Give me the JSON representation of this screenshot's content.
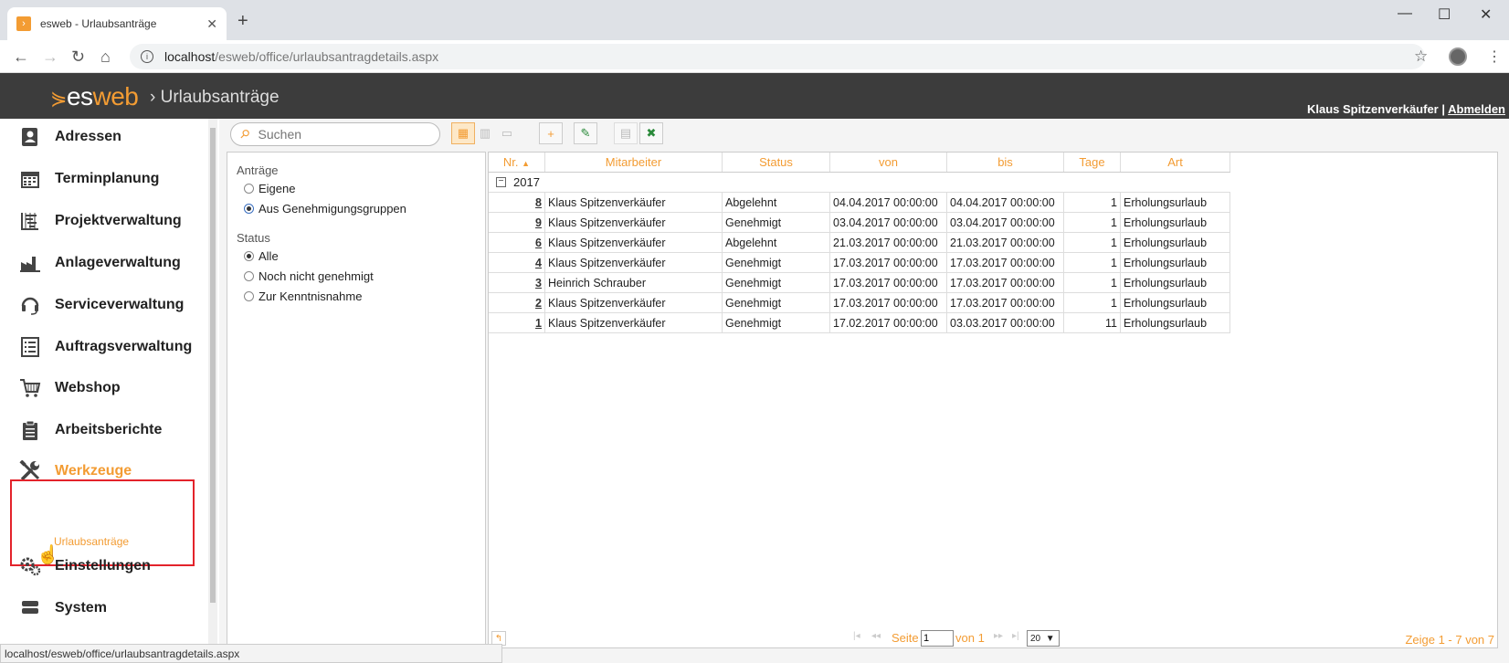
{
  "browser": {
    "tab_title": "esweb - Urlaubsanträge",
    "url_host": "localhost",
    "url_path": "/esweb/office/urlaubsantragdetails.aspx",
    "status_url": "localhost/esweb/office/urlaubsantragdetails.aspx"
  },
  "header": {
    "logo_es": "es",
    "logo_web": "web",
    "breadcrumb": "› Urlaubsanträge",
    "user": "Klaus Spitzenverkäufer",
    "separator": "|",
    "logout": "Abmelden"
  },
  "sidebar": {
    "items": [
      {
        "label": "Adressen",
        "icon": "contacts-icon"
      },
      {
        "label": "Terminplanung",
        "icon": "calendar-icon"
      },
      {
        "label": "Projektverwaltung",
        "icon": "project-icon"
      },
      {
        "label": "Anlageverwaltung",
        "icon": "factory-icon"
      },
      {
        "label": "Serviceverwaltung",
        "icon": "headset-icon"
      },
      {
        "label": "Auftragsverwaltung",
        "icon": "list-icon"
      },
      {
        "label": "Webshop",
        "icon": "cart-icon"
      },
      {
        "label": "Arbeitsberichte",
        "icon": "clipboard-icon"
      },
      {
        "label": "Werkzeuge",
        "icon": "tools-icon",
        "active": true
      },
      {
        "label": "Einstellungen",
        "icon": "gears-icon"
      },
      {
        "label": "System",
        "icon": "server-icon"
      }
    ],
    "subitem": "Urlaubsanträge"
  },
  "toolbar": {
    "search_placeholder": "Suchen"
  },
  "filter": {
    "group1_label": "Anträge",
    "group1_options": [
      "Eigene",
      "Aus Genehmigungsgruppen"
    ],
    "group1_selected": "Aus Genehmigungsgruppen",
    "group2_label": "Status",
    "group2_options": [
      "Alle",
      "Noch nicht genehmigt",
      "Zur Kenntnisnahme"
    ],
    "group2_selected": "Alle"
  },
  "grid": {
    "columns": [
      "Nr.",
      "Mitarbeiter",
      "Status",
      "von",
      "bis",
      "Tage",
      "Art"
    ],
    "group": "2017",
    "rows": [
      {
        "nr": "8",
        "mitarbeiter": "Klaus Spitzenverkäufer",
        "status": "Abgelehnt",
        "von": "04.04.2017 00:00:00",
        "bis": "04.04.2017 00:00:00",
        "tage": "1",
        "art": "Erholungsurlaub"
      },
      {
        "nr": "9",
        "mitarbeiter": "Klaus Spitzenverkäufer",
        "status": "Genehmigt",
        "von": "03.04.2017 00:00:00",
        "bis": "03.04.2017 00:00:00",
        "tage": "1",
        "art": "Erholungsurlaub"
      },
      {
        "nr": "6",
        "mitarbeiter": "Klaus Spitzenverkäufer",
        "status": "Abgelehnt",
        "von": "21.03.2017 00:00:00",
        "bis": "21.03.2017 00:00:00",
        "tage": "1",
        "art": "Erholungsurlaub"
      },
      {
        "nr": "4",
        "mitarbeiter": "Klaus Spitzenverkäufer",
        "status": "Genehmigt",
        "von": "17.03.2017 00:00:00",
        "bis": "17.03.2017 00:00:00",
        "tage": "1",
        "art": "Erholungsurlaub"
      },
      {
        "nr": "3",
        "mitarbeiter": "Heinrich Schrauber",
        "status": "Genehmigt",
        "von": "17.03.2017 00:00:00",
        "bis": "17.03.2017 00:00:00",
        "tage": "1",
        "art": "Erholungsurlaub"
      },
      {
        "nr": "2",
        "mitarbeiter": "Klaus Spitzenverkäufer",
        "status": "Genehmigt",
        "von": "17.03.2017 00:00:00",
        "bis": "17.03.2017 00:00:00",
        "tage": "1",
        "art": "Erholungsurlaub"
      },
      {
        "nr": "1",
        "mitarbeiter": "Klaus Spitzenverkäufer",
        "status": "Genehmigt",
        "von": "17.02.2017 00:00:00",
        "bis": "03.03.2017 00:00:00",
        "tage": "11",
        "art": "Erholungsurlaub"
      }
    ]
  },
  "pager": {
    "page_label": "Seite",
    "page_value": "1",
    "of_label": "von 1",
    "page_size": "20",
    "info": "Zeige 1 - 7 von 7"
  },
  "colors": {
    "accent": "#f39c33",
    "header_bg": "#3c3c3c",
    "highlight_border": "#e3232b"
  }
}
